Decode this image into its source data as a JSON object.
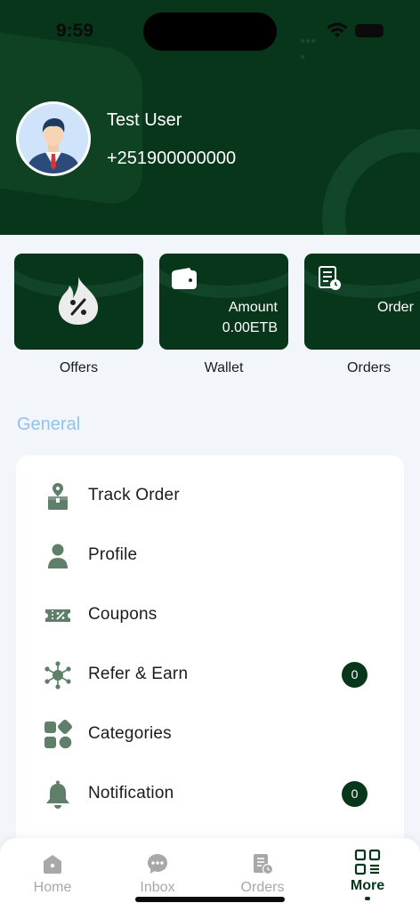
{
  "status_bar": {
    "time": "9:59"
  },
  "profile": {
    "name": "Test User",
    "phone": "+251900000000"
  },
  "cards": {
    "offers": {
      "label": "Offers",
      "icon": "discount-flame-icon"
    },
    "wallet": {
      "label": "Wallet",
      "icon": "wallet-icon",
      "amount_label": "Amount",
      "amount_value": "0.00ETB"
    },
    "orders": {
      "label": "Orders",
      "icon": "order-list-icon",
      "text": "Order"
    }
  },
  "section": {
    "title": "General"
  },
  "menu": {
    "items": [
      {
        "label": "Track Order",
        "icon": "track-order-icon"
      },
      {
        "label": "Profile",
        "icon": "person-icon"
      },
      {
        "label": "Coupons",
        "icon": "coupon-icon"
      },
      {
        "label": "Refer & Earn",
        "icon": "refer-network-icon",
        "badge": "0"
      },
      {
        "label": "Categories",
        "icon": "categories-icon"
      },
      {
        "label": "Notification",
        "icon": "bell-icon",
        "badge": "0"
      }
    ]
  },
  "bottom_nav": {
    "items": [
      {
        "label": "Home",
        "icon": "home-icon"
      },
      {
        "label": "Inbox",
        "icon": "chat-icon"
      },
      {
        "label": "Orders",
        "icon": "orders-icon"
      },
      {
        "label": "More",
        "icon": "grid-menu-icon",
        "active": true
      }
    ]
  },
  "colors": {
    "primary": "#08361a",
    "background": "#f2f6fb",
    "section_title": "#8ec3ee",
    "icon": "#5f7f6b",
    "inactive": "#a8a8a8"
  }
}
